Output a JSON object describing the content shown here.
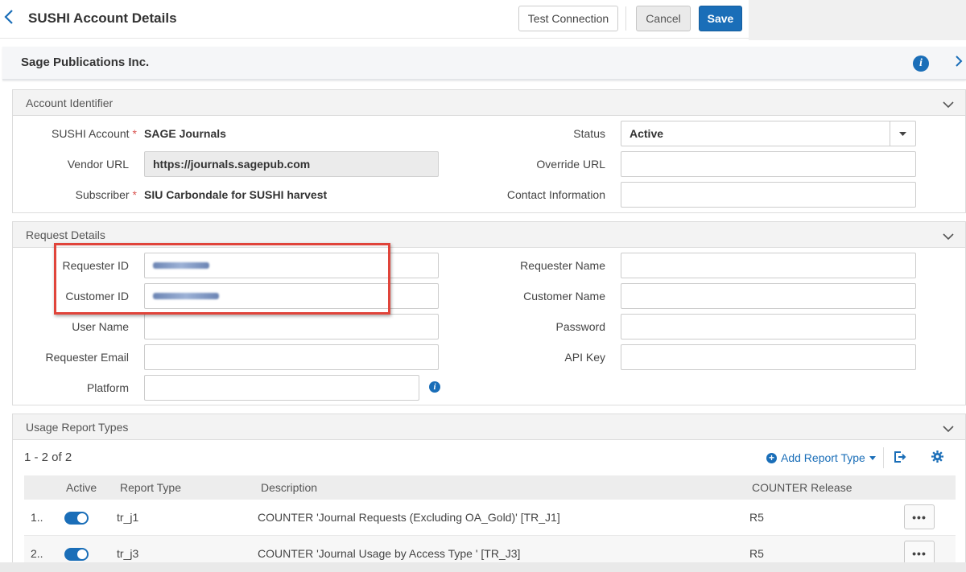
{
  "header": {
    "title": "SUSHI Account Details",
    "test_connection": "Test Connection",
    "cancel": "Cancel",
    "save": "Save"
  },
  "vendor": {
    "name": "Sage Publications Inc."
  },
  "account_identifier": {
    "title": "Account Identifier",
    "sushi_account_label": "SUSHI Account",
    "sushi_account_value": "SAGE Journals",
    "vendor_url_label": "Vendor URL",
    "vendor_url_value": "https://journals.sagepub.com",
    "subscriber_label": "Subscriber",
    "subscriber_value": "SIU Carbondale for SUSHI harvest",
    "status_label": "Status",
    "status_value": "Active",
    "override_url_label": "Override URL",
    "contact_info_label": "Contact Information",
    "required_mark": "*"
  },
  "request_details": {
    "title": "Request Details",
    "requester_id_label": "Requester ID",
    "customer_id_label": "Customer ID",
    "user_name_label": "User Name",
    "requester_email_label": "Requester Email",
    "platform_label": "Platform",
    "requester_name_label": "Requester Name",
    "customer_name_label": "Customer Name",
    "password_label": "Password",
    "api_key_label": "API Key"
  },
  "usage_reports": {
    "title": "Usage Report Types",
    "count": "1 - 2 of 2",
    "add_report_type": "Add Report Type",
    "columns": {
      "active": "Active",
      "report_type": "Report Type",
      "description": "Description",
      "counter_release": "COUNTER Release"
    },
    "rows": [
      {
        "index": "1..",
        "active": true,
        "report_type": "tr_j1",
        "description": "COUNTER 'Journal Requests (Excluding OA_Gold)' [TR_J1]",
        "release": "R5",
        "actions": "•••"
      },
      {
        "index": "2..",
        "active": true,
        "report_type": "tr_j3",
        "description": "COUNTER 'Journal Usage by Access Type ' [TR_J3]",
        "release": "R5",
        "actions": "•••"
      }
    ]
  },
  "colors": {
    "accent": "#1a6eb8",
    "required": "#d9534f",
    "highlight": "#e0443a"
  },
  "icons": [
    "back-chevron-icon",
    "info-icon",
    "chevron-right-icon",
    "chevron-down-icon",
    "caret-down-icon",
    "plus-circle-icon",
    "export-icon",
    "gear-icon"
  ]
}
